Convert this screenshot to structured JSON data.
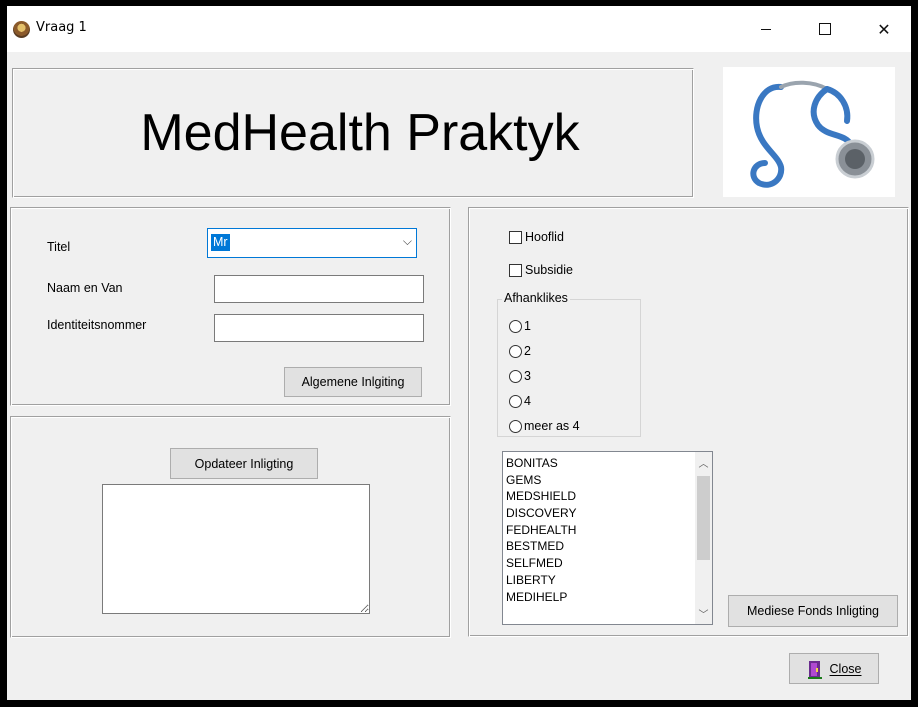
{
  "window": {
    "title": "Vraag 1",
    "controls": {
      "minimize": "—",
      "close": "✕"
    }
  },
  "banner": {
    "title": "MedHealth Praktyk"
  },
  "logo": {
    "icon": "stethoscope-icon"
  },
  "form": {
    "titel_label": "Titel",
    "titel_value": "Mr",
    "naam_label": "Naam en Van",
    "naam_value": "",
    "id_label": "Identiteitsnommer",
    "id_value": "",
    "general_button": "Algemene Inlgiting"
  },
  "update": {
    "button": "Opdateer Inligting",
    "memo_text": ""
  },
  "options": {
    "hooflid_label": "Hooflid",
    "subsidie_label": "Subsidie",
    "group_title": "Afhanklikes",
    "radios": [
      "1",
      "2",
      "3",
      "4",
      "meer as 4"
    ]
  },
  "funds": {
    "items": [
      "BONITAS",
      "GEMS",
      "MEDSHIELD",
      "DISCOVERY",
      "FEDHEALTH",
      "BESTMED",
      "SELFMED",
      "LIBERTY",
      "MEDIHELP"
    ],
    "button": "Mediese Fonds Inligting"
  },
  "footer": {
    "close_label": "Close"
  }
}
